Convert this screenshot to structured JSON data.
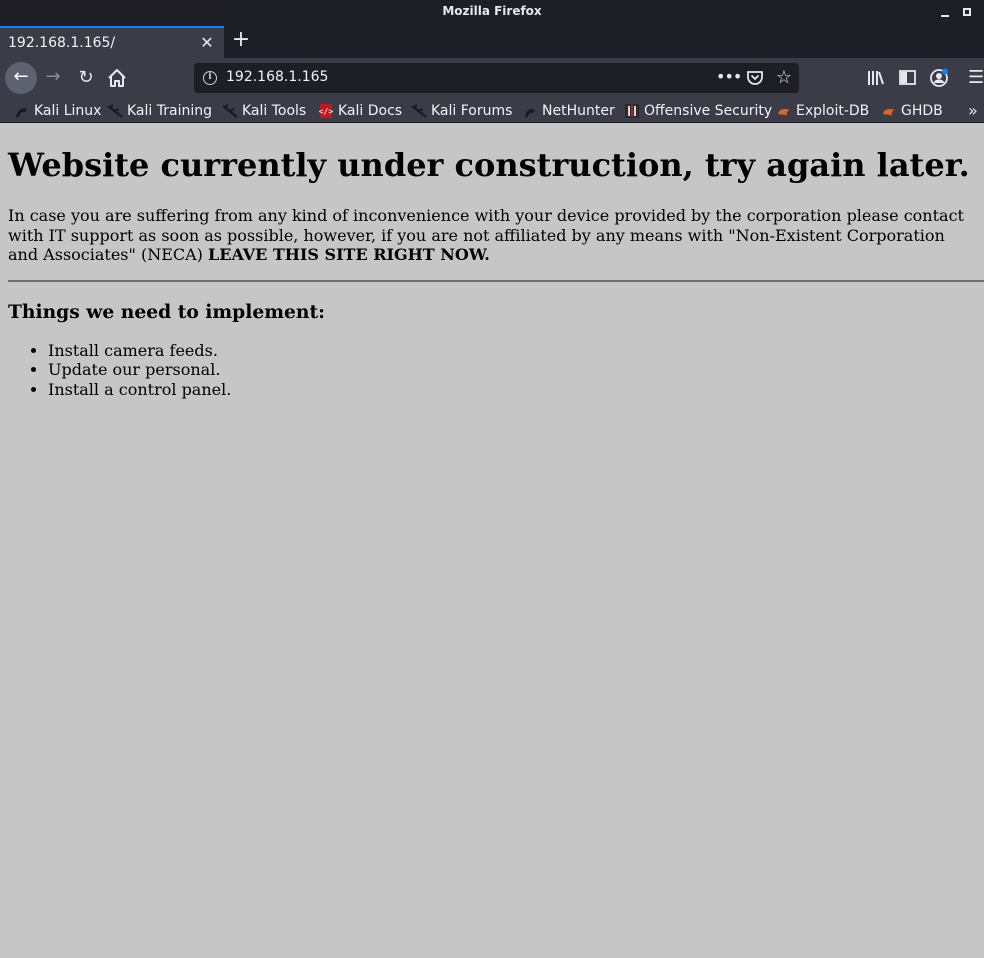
{
  "window": {
    "title": "Mozilla Firefox"
  },
  "tab": {
    "label": "192.168.1.165/"
  },
  "urlbar": {
    "url": "192.168.1.165"
  },
  "bookmarks": [
    {
      "label": "Kali Linux",
      "icon": "kali-dragon-icon"
    },
    {
      "label": "Kali Training",
      "icon": "kali-dragon-icon"
    },
    {
      "label": "Kali Tools",
      "icon": "kali-dragon-icon"
    },
    {
      "label": "Kali Docs",
      "icon": "kali-docs-icon"
    },
    {
      "label": "Kali Forums",
      "icon": "kali-dragon-icon"
    },
    {
      "label": "NetHunter",
      "icon": "nethunter-icon"
    },
    {
      "label": "Offensive Security",
      "icon": "offsec-icon"
    },
    {
      "label": "Exploit-DB",
      "icon": "exploitdb-icon"
    },
    {
      "label": "GHDB",
      "icon": "exploitdb-icon"
    }
  ],
  "page": {
    "heading": "Website currently under construction, try again later.",
    "paragraph_text": "In case you are suffering from any kind of inconvenience with your device provided by the corporation please contact with IT support as soon as possible, however, if you are not affiliated by any means with \"Non-Existent Corporation and Associates\" (NECA) ",
    "paragraph_bold": "LEAVE THIS SITE RIGHT NOW.",
    "subheading": "Things we need to implement:",
    "todo": [
      "Install camera feeds.",
      "Update our personal.",
      "Install a control panel."
    ]
  },
  "colors": {
    "chrome_dark": "#1e1f26",
    "toolbar": "#3a3d48",
    "tab_accent": "#0a84ff",
    "page_background": "#c6c6c6"
  }
}
